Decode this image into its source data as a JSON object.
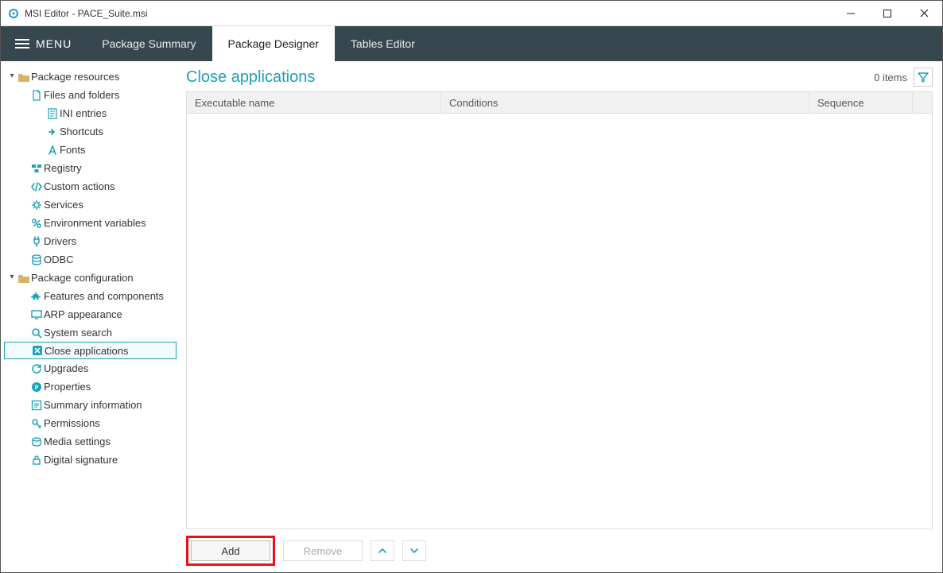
{
  "window": {
    "title": "MSI Editor - PACE_Suite.msi"
  },
  "menubar": {
    "menu_label": "MENU",
    "tabs": [
      {
        "label": "Package Summary",
        "active": false
      },
      {
        "label": "Package Designer",
        "active": true
      },
      {
        "label": "Tables Editor",
        "active": false
      }
    ]
  },
  "tree": {
    "groups": [
      {
        "label": "Package resources",
        "items": [
          {
            "label": "Files and folders",
            "icon": "file-icon"
          },
          {
            "label": "INI entries",
            "icon": "ini-icon",
            "indent": 2
          },
          {
            "label": "Shortcuts",
            "icon": "shortcut-icon",
            "indent": 2
          },
          {
            "label": "Fonts",
            "icon": "font-icon",
            "indent": 2
          },
          {
            "label": "Registry",
            "icon": "registry-icon"
          },
          {
            "label": "Custom actions",
            "icon": "code-icon"
          },
          {
            "label": "Services",
            "icon": "gear-icon"
          },
          {
            "label": "Environment variables",
            "icon": "percent-icon"
          },
          {
            "label": "Drivers",
            "icon": "plug-icon"
          },
          {
            "label": "ODBC",
            "icon": "db-icon"
          }
        ]
      },
      {
        "label": "Package configuration",
        "items": [
          {
            "label": "Features and components",
            "icon": "puzzle-icon"
          },
          {
            "label": "ARP appearance",
            "icon": "monitor-icon"
          },
          {
            "label": "System search",
            "icon": "search-icon"
          },
          {
            "label": "Close applications",
            "icon": "close-box-icon",
            "selected": true
          },
          {
            "label": "Upgrades",
            "icon": "refresh-icon"
          },
          {
            "label": "Properties",
            "icon": "p-icon"
          },
          {
            "label": "Summary information",
            "icon": "info-icon"
          },
          {
            "label": "Permissions",
            "icon": "key-icon"
          },
          {
            "label": "Media settings",
            "icon": "disc-icon"
          },
          {
            "label": "Digital signature",
            "icon": "lock-icon"
          }
        ]
      }
    ]
  },
  "main": {
    "title": "Close applications",
    "items_count": "0 items",
    "columns": {
      "exec": "Executable name",
      "cond": "Conditions",
      "seq": "Sequence"
    },
    "footer": {
      "add": "Add",
      "remove": "Remove"
    }
  }
}
